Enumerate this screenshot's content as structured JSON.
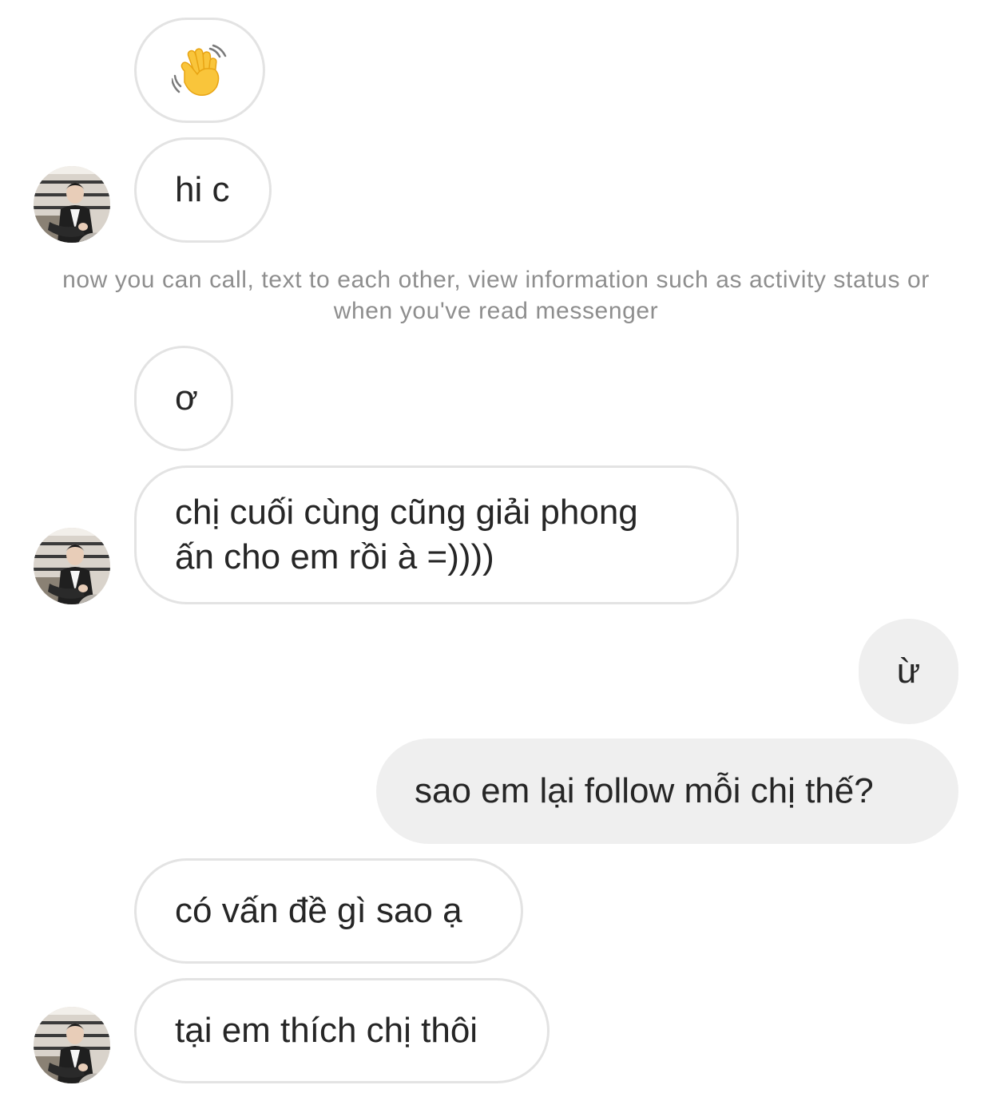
{
  "messages": {
    "m1": {
      "sender": "other",
      "content": "wave-icon"
    },
    "m2": {
      "sender": "other",
      "text": "hi c"
    },
    "system_note": "now you can call, text to each other, view information such as activity status or when you've read messenger",
    "m3": {
      "sender": "other",
      "text": "ơ"
    },
    "m4": {
      "sender": "other",
      "line1": "chị cuối cùng cũng giải phong",
      "line2": "ấn cho em rồi à =))))"
    },
    "m5": {
      "sender": "me",
      "text": "ừ"
    },
    "m6": {
      "sender": "me",
      "text": "sao em lại follow mỗi chị thế?"
    },
    "m7": {
      "sender": "other",
      "text": "có vấn đề gì sao ạ"
    },
    "m8": {
      "sender": "other",
      "text": "tại em thích chị thôi"
    }
  },
  "colors": {
    "incoming_border": "#e3e3e3",
    "outgoing_bg": "#efefef",
    "system_text": "#8e8e8e",
    "message_text": "#262626"
  }
}
